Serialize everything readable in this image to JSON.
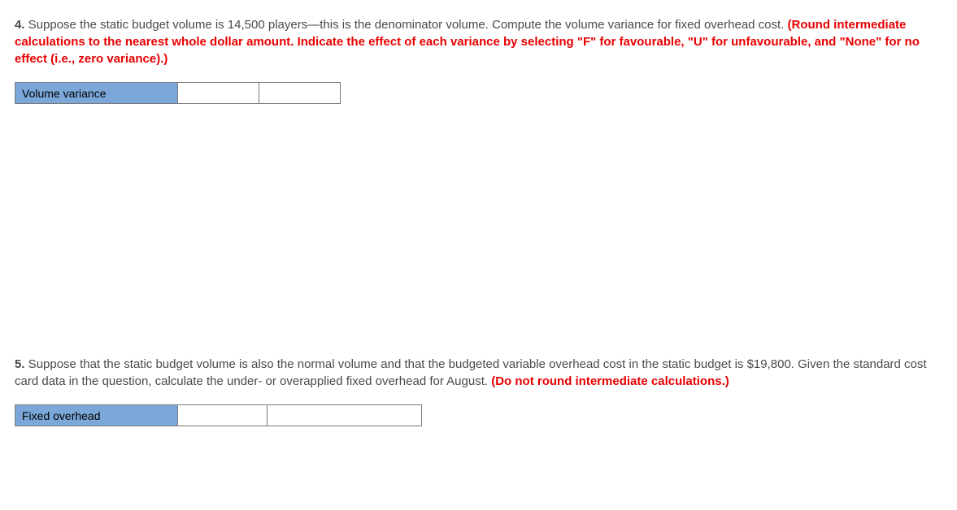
{
  "question4": {
    "number": "4.",
    "text_part1": " Suppose the static budget volume is 14,500 players—this is the denominator volume. Compute the volume variance for fixed overhead cost. ",
    "instruction": "(Round intermediate calculations to the nearest whole dollar amount. Indicate the effect of each variance by selecting \"F\" for favourable, \"U\" for unfavourable, and \"None\" for no effect (i.e., zero variance).)",
    "table_label": "Volume variance"
  },
  "question5": {
    "number": "5.",
    "text_part1": " Suppose that the static budget volume is also the normal volume and that the budgeted variable overhead cost in the static budget is $19,800. Given the standard cost card data in the question, calculate the under- or overapplied fixed overhead for August. ",
    "instruction": "(Do not round intermediate calculations.)",
    "table_label": "Fixed overhead"
  }
}
